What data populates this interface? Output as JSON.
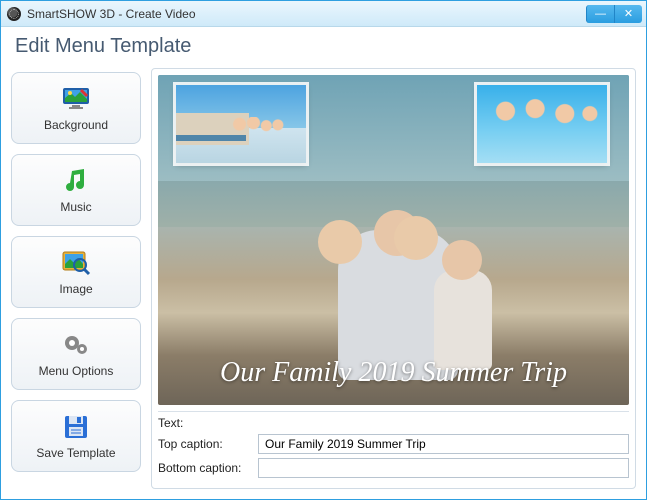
{
  "window": {
    "title": "SmartSHOW 3D - Create Video"
  },
  "header": {
    "title": "Edit Menu Template"
  },
  "sidebar": {
    "items": [
      {
        "label": "Background"
      },
      {
        "label": "Music"
      },
      {
        "label": "Image"
      },
      {
        "label": "Menu Options"
      },
      {
        "label": "Save Template"
      }
    ]
  },
  "preview": {
    "caption_text": "Our Family 2019 Summer Trip"
  },
  "text_panel": {
    "section_label": "Text:",
    "top_caption_label": "Top caption:",
    "top_caption_value": "Our Family 2019 Summer Trip",
    "bottom_caption_label": "Bottom caption:",
    "bottom_caption_value": ""
  }
}
